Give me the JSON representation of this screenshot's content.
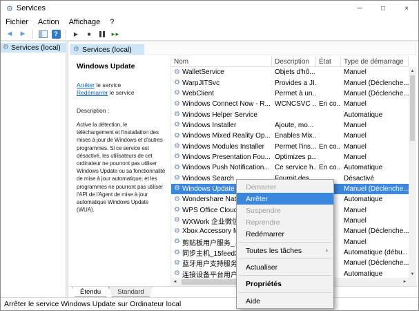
{
  "window": {
    "title": "Services"
  },
  "menu_bar": {
    "items": [
      "Fichier",
      "Action",
      "Affichage",
      "?"
    ]
  },
  "tree": {
    "root_label": "Services (local)"
  },
  "right_header": {
    "label": "Services (local)"
  },
  "info_pane": {
    "service_name": "Windows Update",
    "stop_link": {
      "action": "Arrêter",
      "suffix": " le service"
    },
    "restart_link": {
      "action": "Redémarrer",
      "suffix": " le service"
    },
    "description_label": "Description :",
    "description_text": "Active la détection, le téléchargement et l'installation des mises à jour de Windows et d'autres programmes. Si ce service est désactivé, les utilisateurs de cet ordinateur ne pourront pas utiliser Windows Update ou sa fonctionnalité de mise à jour automatique, et les programmes ne pourront pas utiliser l'API de l'Agent de mise à jour automatique Windows Update (WUA)."
  },
  "table": {
    "columns": [
      "Nom",
      "Description",
      "État",
      "Type de démarrage"
    ],
    "rows": [
      {
        "name": "WalletService",
        "description": "Objets d'hô...",
        "state": "",
        "startup": "Manuel",
        "selected": false
      },
      {
        "name": "WarpJITSvc",
        "description": "Provides a JI...",
        "state": "",
        "startup": "Manuel (Déclenche...",
        "selected": false
      },
      {
        "name": "WebClient",
        "description": "Permet à un...",
        "state": "",
        "startup": "Manuel (Déclenche...",
        "selected": false
      },
      {
        "name": "Windows Connect Now - R...",
        "description": "WCNCSVC ...",
        "state": "En co...",
        "startup": "Manuel",
        "selected": false
      },
      {
        "name": "Windows Helper Service",
        "description": "",
        "state": "",
        "startup": "Automatique",
        "selected": false
      },
      {
        "name": "Windows Installer",
        "description": "Ajoute, mo...",
        "state": "",
        "startup": "Manuel",
        "selected": false
      },
      {
        "name": "Windows Mixed Reality Op...",
        "description": "Enables Mix...",
        "state": "",
        "startup": "Manuel",
        "selected": false
      },
      {
        "name": "Windows Modules Installer",
        "description": "Permet l'ins...",
        "state": "En co...",
        "startup": "Manuel",
        "selected": false
      },
      {
        "name": "Windows Presentation Fou...",
        "description": "Optimizes p...",
        "state": "",
        "startup": "Manuel",
        "selected": false
      },
      {
        "name": "Windows Push Notification...",
        "description": "Ce service h...",
        "state": "En co...",
        "startup": "Automatique",
        "selected": false
      },
      {
        "name": "Windows Search",
        "description": "Fournit des ...",
        "state": "",
        "startup": "Désactivé",
        "selected": false
      },
      {
        "name": "Windows Update",
        "description": "",
        "state": "",
        "startup": "Manuel (Déclenche...",
        "selected": true
      },
      {
        "name": "Wondershare Nativ...",
        "description": "",
        "state": "",
        "startup": "Automatique",
        "selected": false
      },
      {
        "name": "WPS Office Cloud S...",
        "description": "",
        "state": "",
        "startup": "Manuel",
        "selected": false
      },
      {
        "name": "WXWork 企业微信...",
        "description": "",
        "state": "",
        "startup": "Manuel",
        "selected": false
      },
      {
        "name": "Xbox Accessory Ma...",
        "description": "",
        "state": "",
        "startup": "Manuel (Déclenche...",
        "selected": false
      },
      {
        "name": "剪贴板用户服务_...",
        "description": "",
        "state": "",
        "startup": "Manuel",
        "selected": false
      },
      {
        "name": "同步主机_15feed3...",
        "description": "",
        "state": "",
        "startup": "Automatique (débu...",
        "selected": false
      },
      {
        "name": "蓝牙用户支持服务...",
        "description": "",
        "state": "",
        "startup": "Manuel (Déclenche...",
        "selected": false
      },
      {
        "name": "连接设备平台用户...",
        "description": "",
        "state": "",
        "startup": "Automatique",
        "selected": false
      }
    ]
  },
  "context_menu": {
    "items": [
      {
        "key": "demarrer",
        "label": "Démarrer",
        "disabled": true
      },
      {
        "key": "arreter",
        "label": "Arrêter",
        "highlighted": true
      },
      {
        "key": "suspendre",
        "label": "Suspendre",
        "disabled": true
      },
      {
        "key": "reprendre",
        "label": "Reprendre",
        "disabled": true
      },
      {
        "key": "redemarrer",
        "label": "Redémarrer"
      },
      {
        "separator": true
      },
      {
        "key": "toutes-les-taches",
        "label": "Toutes les tâches",
        "submenu": true
      },
      {
        "separator": true
      },
      {
        "key": "actualiser",
        "label": "Actualiser"
      },
      {
        "separator": true
      },
      {
        "key": "proprietes",
        "label": "Propriétés",
        "bold": true
      },
      {
        "separator": true
      },
      {
        "key": "aide",
        "label": "Aide"
      }
    ]
  },
  "tabs": {
    "extended": "Étendu",
    "standard": "Standard"
  },
  "status_bar": {
    "text": "Arrêter le service Windows Update sur Ordinateur local"
  },
  "icons": {
    "gear": "⚙",
    "minimize": "─",
    "maximize": "□",
    "close": "×",
    "back": "◄",
    "forward": "►",
    "help": "?",
    "start": "▶",
    "stop": "■",
    "restart": "►►",
    "submenu": "›",
    "sort": "ˆ",
    "scroll_left": "◄",
    "scroll_right": "►",
    "scroll_up": "▲",
    "scroll_down": "▼"
  },
  "colors": {
    "selection": "#3a87dd",
    "link": "#0563c1",
    "tree_selection": "#cde6f7"
  }
}
